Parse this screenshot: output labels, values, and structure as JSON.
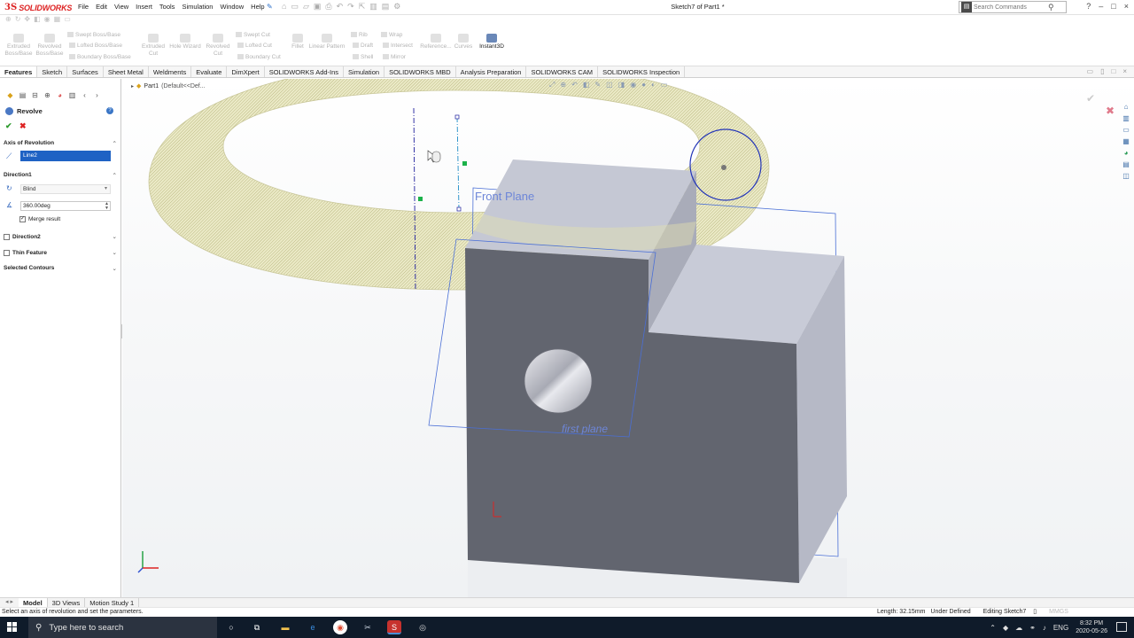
{
  "app": {
    "logo_text": "SOLIDWORKS",
    "menus": [
      "File",
      "Edit",
      "View",
      "Insert",
      "Tools",
      "Simulation",
      "Window",
      "Help"
    ],
    "document_title": "Sketch7 of Part1 *",
    "search_placeholder": "Search Commands",
    "window_controls": [
      "?",
      "–",
      "□",
      "×"
    ]
  },
  "command_manager": {
    "large": [
      {
        "label": "Extruded\nBoss/Base"
      },
      {
        "label": "Revolved\nBoss/Base"
      },
      {
        "label": "Extruded\nCut"
      },
      {
        "label": "Hole Wizard"
      },
      {
        "label": "Revolved\nCut"
      },
      {
        "label": "Fillet"
      },
      {
        "label": "Linear Pattern"
      },
      {
        "label": "Reference..."
      },
      {
        "label": "Curves"
      },
      {
        "label": "Instant3D"
      }
    ],
    "small": [
      "Swept Boss/Base",
      "Lofted Boss/Base",
      "Boundary Boss/Base",
      "Swept Cut",
      "Lofted Cut",
      "Boundary Cut",
      "Rib",
      "Draft",
      "Shell",
      "Wrap",
      "Intersect",
      "Mirror"
    ]
  },
  "tabs": [
    "Features",
    "Sketch",
    "Surfaces",
    "Sheet Metal",
    "Weldments",
    "Evaluate",
    "DimXpert",
    "SOLIDWORKS Add-Ins",
    "Simulation",
    "SOLIDWORKS MBD",
    "Analysis Preparation",
    "SOLIDWORKS CAM",
    "SOLIDWORKS Inspection"
  ],
  "active_tab": "Features",
  "property_manager": {
    "title": "Revolve",
    "axis_section": "Axis of Revolution",
    "axis_value": "Line2",
    "direction1_section": "Direction1",
    "end_condition": "Blind",
    "angle": "360.00deg",
    "merge_result": "Merge result",
    "merge_checked": true,
    "direction2": "Direction2",
    "thin_feature": "Thin Feature",
    "selected_contours": "Selected Contours"
  },
  "viewport": {
    "breadcrumb_part": "Part1",
    "breadcrumb_config": "(Default<<Def...",
    "front_plane_label": "Front Plane",
    "first_plane_label": "first plane",
    "colors": {
      "torus": "#e5e3b8",
      "body_dark": "#62656f",
      "body_light": "#c7cad6",
      "plane": "#3d63d6"
    }
  },
  "bottom_tabs": [
    "Model",
    "3D Views",
    "Motion Study 1"
  ],
  "active_bottom_tab": "Model",
  "status": {
    "message": "Select an axis of revolution and set the parameters.",
    "length": "Length: 32.15mm",
    "state": "Under Defined",
    "editing": "Editing Sketch7",
    "units": "MMGS"
  },
  "taskbar": {
    "search_placeholder": "Type here to search",
    "language": "ENG",
    "time": "8:32 PM",
    "date": "2020-05-26"
  }
}
